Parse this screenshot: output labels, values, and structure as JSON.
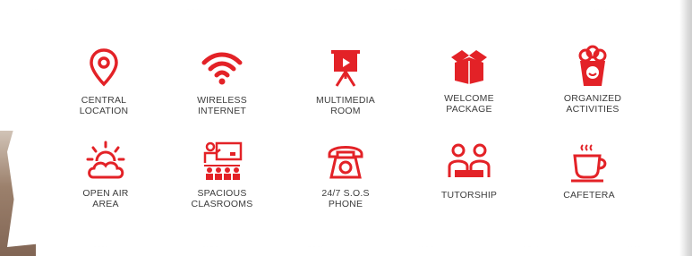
{
  "theme": {
    "accent": "#e32227",
    "text": "#3c3c3c"
  },
  "amenities": [
    {
      "label": "CENTRAL\nLOCATION",
      "icon": "location-pin-icon"
    },
    {
      "label": "WIRELESS\nINTERNET",
      "icon": "wifi-icon"
    },
    {
      "label": "MULTIMEDIA\nROOM",
      "icon": "projector-screen-icon"
    },
    {
      "label": "WELCOME\nPACKAGE",
      "icon": "open-box-icon"
    },
    {
      "label": "ORGANIZED\nACTIVITIES",
      "icon": "popcorn-icon"
    },
    {
      "label": "OPEN AIR\nAREA",
      "icon": "sun-cloud-icon"
    },
    {
      "label": "SPACIOUS\nCLASROOMS",
      "icon": "classroom-icon"
    },
    {
      "label": "24/7 S.O.S\nPHONE",
      "icon": "telephone-icon"
    },
    {
      "label": "TUTORSHIP",
      "icon": "people-desk-icon"
    },
    {
      "label": "CAFETERA",
      "icon": "coffee-cup-icon"
    }
  ]
}
